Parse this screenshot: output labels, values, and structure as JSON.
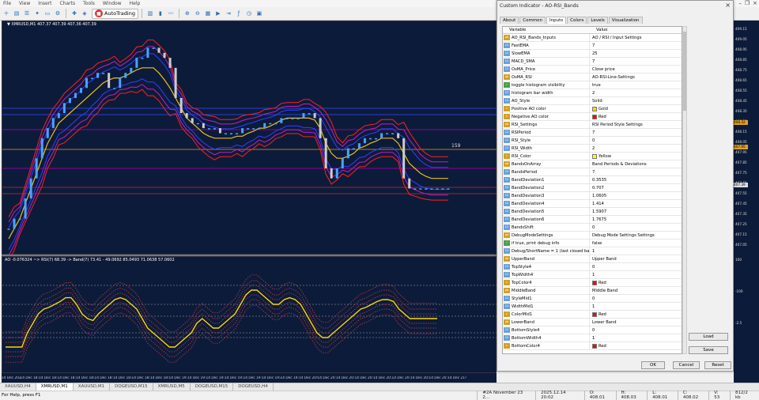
{
  "menu": [
    "File",
    "View",
    "Insert",
    "Charts",
    "Tools",
    "Window",
    "Help"
  ],
  "toolbar": {
    "autotrading": "AutoTrading"
  },
  "chart_main": {
    "title": "▼ XMRUSD,M1  407.37 407.39 407.36 407.39",
    "price_label": "159"
  },
  "chart_sub": {
    "title": "AO -0.076324 ~> RSI(7) 68.39 -> Band(7) 73.41 - 49.0692 85.0493 71.0638 57.0602"
  },
  "time_axis": [
    "14 Dec 2025",
    "14 Dec 18:03",
    "14 Dec 18:11",
    "14 Dec 18:19",
    "14 Dec 18:27",
    "14 Dec 18:35",
    "14 Dec 18:43",
    "14 Dec 18:51",
    "14 Dec 18:59",
    "14 Dec 19:07",
    "14 Dec 19:15",
    "14 Dec 19:23",
    "14 Dec 19:31",
    "14 Dec 19:39",
    "14 Dec 19:47",
    "14 Dec 19:55",
    "14 Dec 20:03",
    "14 Dec 20:11",
    "14 Dec 20:19",
    "14 Dec 20:27",
    "14 Dec 20:35",
    "14 Dec 20:43",
    "14 Dec 20:51",
    "14 Dec 20:59",
    "14 Dec 21:07"
  ],
  "right_axis": [
    {
      "label": "409.15"
    },
    {
      "label": "409.05"
    },
    {
      "label": "408.95"
    },
    {
      "label": "408.85"
    },
    {
      "label": "408.75"
    },
    {
      "label": "408.65"
    },
    {
      "label": "408.55"
    },
    {
      "label": "408.45"
    },
    {
      "label": "408.35"
    },
    {
      "label": "408.25"
    },
    {
      "label": "408.15"
    },
    {
      "label": "408.05"
    },
    {
      "label": "407.95"
    },
    {
      "label": "407.85"
    },
    {
      "label": "407.75"
    },
    {
      "label": "407.65"
    },
    {
      "label": "407.55"
    },
    {
      "label": "407.45"
    },
    {
      "label": "407.35"
    },
    {
      "label": "407.25"
    },
    {
      "label": "407.15"
    },
    {
      "label": "407.05"
    },
    {
      "label": "100"
    },
    {
      "label": "-100"
    },
    {
      "label": "-2.5"
    }
  ],
  "right_axis_highlights": [
    {
      "label": "408.42",
      "color": "#e0a020"
    },
    {
      "label": "407.95",
      "color": "#e0a020"
    },
    {
      "label": "407.39",
      "color": "#dddddd"
    }
  ],
  "tabs": [
    {
      "label": "XAUUSD,H4"
    },
    {
      "label": "XMRUSD,M1",
      "active": true
    },
    {
      "label": "XAUUSD,M1"
    },
    {
      "label": "DOGEUSD,M15"
    },
    {
      "label": "XMRUSD,M5"
    },
    {
      "label": "DOGEUSD,M15"
    },
    {
      "label": "DOGEUSD,H4"
    }
  ],
  "status": {
    "help": "For Help, press F1",
    "cells": [
      "#2A November 23 2...",
      "2025.12.14 20:02",
      "O: 408.01",
      "H: 408.03",
      "L: 408.01",
      "C: 408.02",
      "V: 53",
      "812/2 kb"
    ]
  },
  "dialog": {
    "title": "Custom Indicator - AO-RSI_Bands",
    "tabs": [
      {
        "label": "About"
      },
      {
        "label": "Common"
      },
      {
        "label": "Inputs",
        "active": true
      },
      {
        "label": "Colors"
      },
      {
        "label": "Levels"
      },
      {
        "label": "Visualization"
      }
    ],
    "col_variable": "Variable",
    "col_value": "Value",
    "rows": [
      {
        "icon": "abc",
        "name": "AO_RSI_Bands_Inputs",
        "value": "AO / RSI / Input Settings"
      },
      {
        "icon": "123",
        "name": "FastEMA",
        "value": "7"
      },
      {
        "icon": "123",
        "name": "SlowEMA",
        "value": "25"
      },
      {
        "icon": "123",
        "name": "MACD_SMA",
        "value": "7"
      },
      {
        "icon": "123",
        "name": "OsMA_Price",
        "value": "Close price"
      },
      {
        "icon": "abc",
        "name": "OsMA_RSI",
        "value": "AO-RSI-Line-Settings"
      },
      {
        "icon": "bool",
        "name": "toggle histogram visibility",
        "value": "true"
      },
      {
        "icon": "123",
        "name": "histogram bar width",
        "value": "2"
      },
      {
        "icon": "123",
        "name": "AO_Style",
        "value": "Solid"
      },
      {
        "icon": "clr",
        "name": "Positive AO color",
        "value": "Gold",
        "color": "#ffd700"
      },
      {
        "icon": "clr",
        "name": "Negative AO color",
        "value": "Red",
        "color": "#ff0000"
      },
      {
        "icon": "abc",
        "name": "RSI_Settings",
        "value": "RSI Period Style Settings"
      },
      {
        "icon": "123",
        "name": "RSIPeriod",
        "value": "7"
      },
      {
        "icon": "123",
        "name": "RSI_Style",
        "value": "0"
      },
      {
        "icon": "123",
        "name": "RSI_Width",
        "value": "2"
      },
      {
        "icon": "clr",
        "name": "RSI_Color",
        "value": "Yellow",
        "color": "#ffff00"
      },
      {
        "icon": "abc",
        "name": "BandsOnArray",
        "value": "Band Periods & Deviations"
      },
      {
        "icon": "123",
        "name": "BandsPeriod",
        "value": "7"
      },
      {
        "icon": "123",
        "name": "BandDeviation1",
        "value": "0.3535"
      },
      {
        "icon": "123",
        "name": "BandDeviation2",
        "value": "0.707"
      },
      {
        "icon": "123",
        "name": "BandDeviation3",
        "value": "1.0605"
      },
      {
        "icon": "123",
        "name": "BandDeviation4",
        "value": "1.414"
      },
      {
        "icon": "123",
        "name": "BandDeviation5",
        "value": "1.5907"
      },
      {
        "icon": "123",
        "name": "BandDeviation6",
        "value": "1.7675"
      },
      {
        "icon": "123",
        "name": "BandsShift",
        "value": "0"
      },
      {
        "icon": "abc",
        "name": "DebugModeSettings",
        "value": "Debug Mode Settings Settings"
      },
      {
        "icon": "bool",
        "name": "if true, print debug info",
        "value": "false"
      },
      {
        "icon": "123",
        "name": "Debug/ShortName = 1 (last closed bar)",
        "value": "1"
      },
      {
        "icon": "abc",
        "name": "UpperBand",
        "value": "Upper Band"
      },
      {
        "icon": "123",
        "name": "TopStyle4",
        "value": "0"
      },
      {
        "icon": "123",
        "name": "TopWidth4",
        "value": "1"
      },
      {
        "icon": "clr",
        "name": "TopColor4",
        "value": "Red",
        "color": "#ff0000"
      },
      {
        "icon": "abc",
        "name": "MiddleBand",
        "value": "Middle Band"
      },
      {
        "icon": "123",
        "name": "StyleMid1",
        "value": "0"
      },
      {
        "icon": "123",
        "name": "WidthMid1",
        "value": "1"
      },
      {
        "icon": "clr",
        "name": "ColorMid1",
        "value": "Red",
        "color": "#ff0000"
      },
      {
        "icon": "abc",
        "name": "LowerBand",
        "value": "Lower Band"
      },
      {
        "icon": "123",
        "name": "BottomStyle4",
        "value": "0"
      },
      {
        "icon": "123",
        "name": "BottomWidth4",
        "value": "1"
      },
      {
        "icon": "clr",
        "name": "BottomColor4",
        "value": "Red",
        "color": "#ff0000"
      }
    ],
    "buttons": {
      "load": "Load",
      "save": "Save",
      "ok": "OK",
      "cancel": "Cancel",
      "reset": "Reset"
    }
  },
  "chart_data": [
    {
      "type": "line",
      "title": "XMRUSD,M1",
      "x_count": 80,
      "series": [
        {
          "name": "price",
          "color": "#4aa3ff",
          "values": [
            407.2,
            407.3,
            407.3,
            407.5,
            407.7,
            407.9,
            408.1,
            408.2,
            408.3,
            408.35,
            408.45,
            408.5,
            408.55,
            408.6,
            408.7,
            408.7,
            408.75,
            408.75,
            408.6,
            408.6,
            408.7,
            408.75,
            408.8,
            408.9,
            408.9,
            409.0,
            409.0,
            408.95,
            408.9,
            408.8,
            408.5,
            408.35,
            408.3,
            408.25,
            408.25,
            408.2,
            408.2,
            408.2,
            408.15,
            408.15,
            408.15,
            408.15,
            408.2,
            408.2,
            408.2,
            408.2,
            408.25,
            408.25,
            408.25,
            408.3,
            408.3,
            408.3,
            408.3,
            408.35,
            408.35,
            408.3,
            408.1,
            407.8,
            407.7,
            407.8,
            407.9,
            408.0,
            408.0,
            408.05,
            408.1,
            408.1,
            408.1,
            408.15,
            408.15,
            408.15,
            408.1,
            407.7,
            407.6,
            407.6,
            407.6,
            407.6,
            407.6,
            407.6,
            407.6,
            407.6
          ]
        },
        {
          "name": "band-mid",
          "color": "#e8c020",
          "values": [
            407.1,
            407.2,
            407.3,
            407.45,
            407.6,
            407.75,
            407.9,
            408.05,
            408.15,
            408.25,
            408.3,
            408.35,
            408.4,
            408.45,
            408.5,
            408.55,
            408.6,
            408.65,
            408.68,
            408.7,
            408.7,
            408.72,
            408.75,
            408.78,
            408.8,
            408.8,
            408.8,
            408.75,
            408.68,
            408.6,
            408.5,
            408.4,
            408.3,
            408.25,
            408.2,
            408.15,
            408.12,
            408.1,
            408.1,
            408.1,
            408.1,
            408.12,
            408.12,
            408.15,
            408.17,
            408.2,
            408.2,
            408.22,
            408.25,
            408.28,
            408.3,
            408.3,
            408.3,
            408.3,
            408.3,
            408.28,
            408.2,
            408.05,
            407.95,
            407.9,
            407.9,
            407.92,
            407.95,
            408.0,
            408.02,
            408.05,
            408.07,
            408.1,
            408.1,
            408.1,
            408.05,
            407.95,
            407.85,
            407.8,
            407.75,
            407.72,
            407.7,
            407.7,
            407.7,
            407.7
          ]
        }
      ]
    },
    {
      "type": "line",
      "title": "AO -0.076324 ~> RSI(7) 68.39 -> Band(7) 73.41 - 49.0692 85.0493 71.0638 57.0602",
      "x_count": 80,
      "series": [
        {
          "name": "RSI(7)",
          "color": "#ffd700",
          "values": [
            20,
            20,
            20,
            20,
            35,
            45,
            55,
            60,
            62,
            65,
            68,
            72,
            72,
            65,
            55,
            50,
            48,
            55,
            60,
            65,
            70,
            72,
            70,
            65,
            60,
            50,
            40,
            35,
            30,
            25,
            20,
            20,
            25,
            30,
            35,
            45,
            50,
            45,
            40,
            40,
            45,
            50,
            55,
            65,
            75,
            80,
            80,
            75,
            70,
            65,
            65,
            70,
            72,
            70,
            65,
            55,
            45,
            35,
            30,
            30,
            35,
            40,
            45,
            50,
            55,
            60,
            62,
            65,
            68,
            70,
            70,
            68,
            60,
            55,
            50,
            50,
            50,
            50,
            50,
            50
          ]
        }
      ]
    }
  ]
}
